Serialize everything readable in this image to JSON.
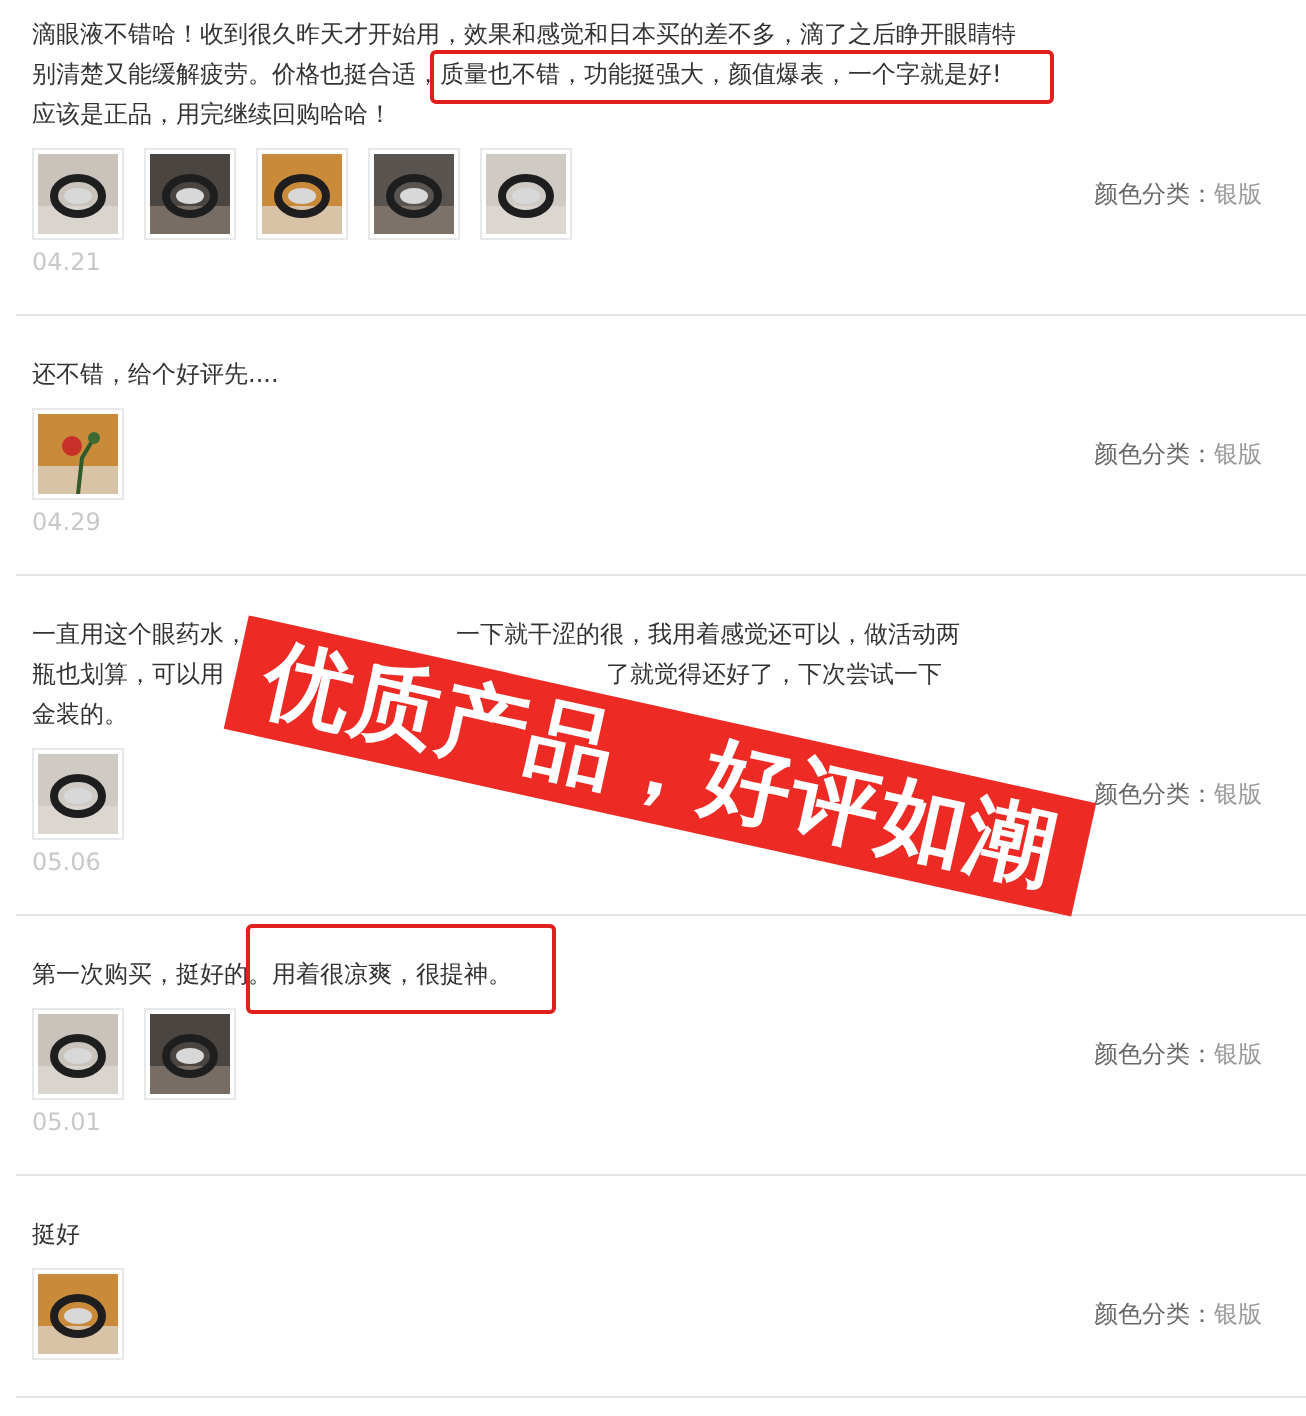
{
  "reviews": [
    {
      "kind": "plain",
      "lines": [
        [
          "滴眼液不错哈！收到很久昨天才开始用，效果和感觉和日本买的差不多，滴了之后睁开眼睛特"
        ],
        [
          "别清楚又能缓解疲劳。价格也挺合适，",
          "质量也不错，功能挺强大，颜值爆表，一个字就是好!"
        ],
        [
          "应该是正品，用完继续回购哈哈！"
        ]
      ],
      "photos": [
        {
          "kind": "picture"
        },
        {
          "kind": "picture"
        },
        {
          "kind": "picture"
        },
        {
          "kind": "picture"
        },
        {
          "kind": "picture"
        }
      ],
      "date": "04.21",
      "spec": {
        "label": "颜色分类：",
        "value": "银版"
      }
    },
    {
      "text": "还不错，给个好评先....",
      "photos": [
        {
          "kind": "picture"
        }
      ],
      "date": "04.29",
      "spec": {
        "label": "颜色分类：",
        "value": "银版"
      }
    },
    {
      "kind": "covered",
      "lines": [
        [
          "一直用这个眼药水，",
          "一下就干涩的很，我用着感觉还可以，做活动两"
        ],
        [
          "瓶也划算，可以用",
          "了就觉得还好了，下次尝试一下"
        ],
        [
          "金装的。"
        ]
      ],
      "photos": [
        {
          "kind": "picture"
        }
      ],
      "date": "05.06",
      "spec": {
        "label": "颜色分类：",
        "value": "银版"
      }
    },
    {
      "text": "第一次购买，挺好的。用着很凉爽，很提神。",
      "photos": [
        {
          "kind": "picture"
        },
        {
          "kind": "picture"
        }
      ],
      "date": "05.01",
      "spec": {
        "label": "颜色分类：",
        "value": "银版"
      }
    },
    {
      "text": "挺好",
      "photos": [
        {
          "kind": "picture"
        }
      ],
      "spec": {
        "label": "颜色分类：",
        "value": "银版"
      }
    }
  ],
  "banner": {
    "text": "优质产品，好评如潮"
  }
}
